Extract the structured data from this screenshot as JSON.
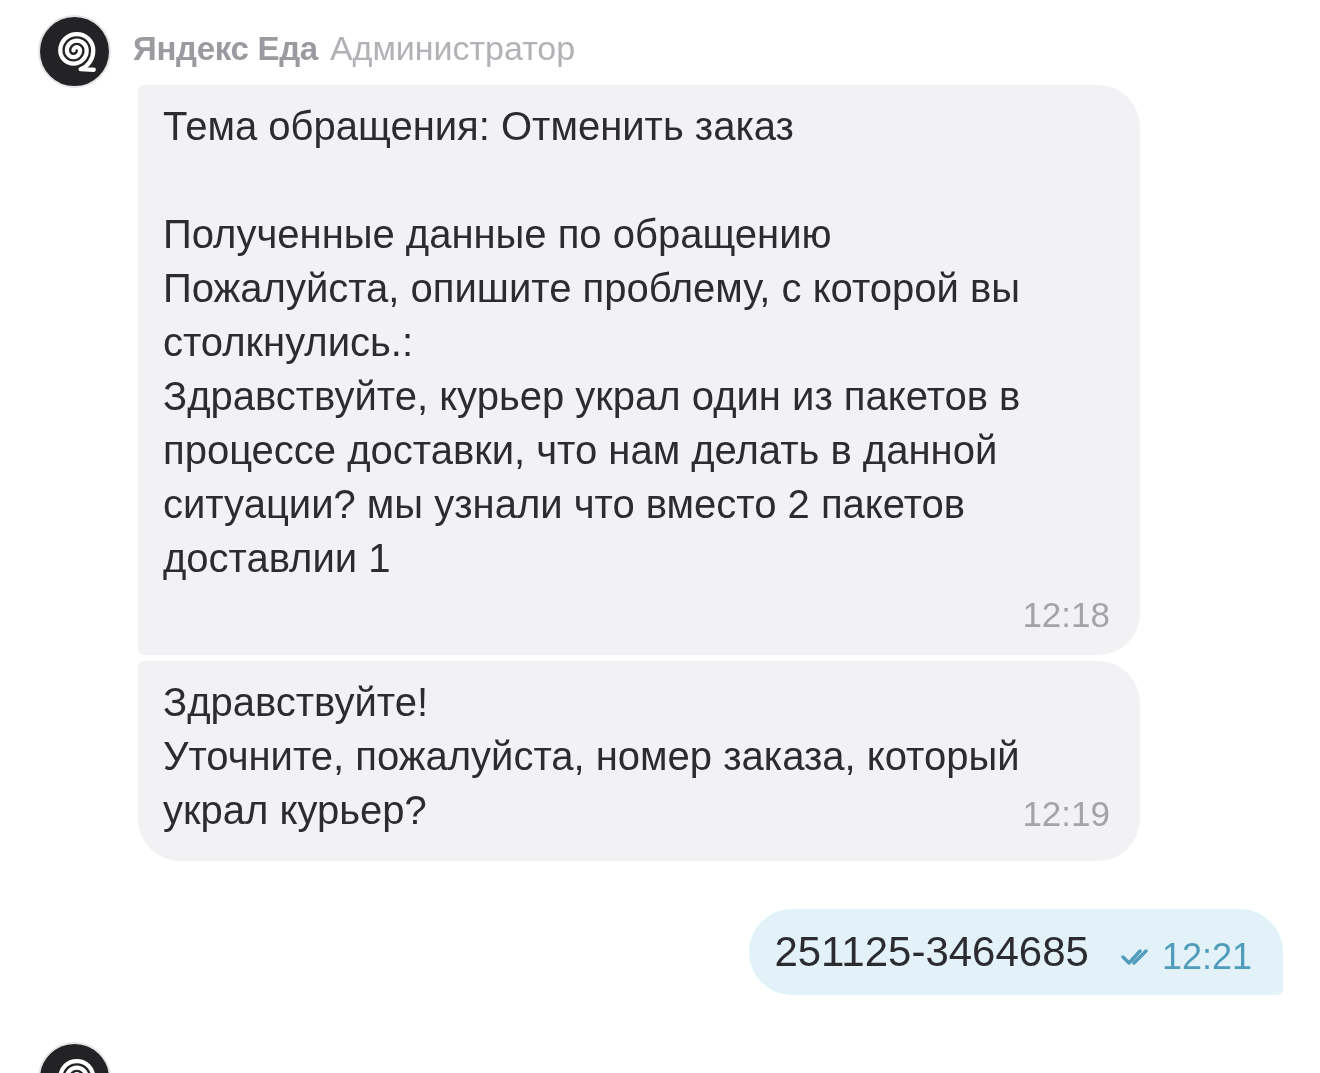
{
  "groups": [
    {
      "kind": "incoming",
      "sender": {
        "name": "Яндекс Еда",
        "role": "Администратор"
      },
      "messages": [
        {
          "kind": "ticket",
          "text": "Тема обращения: Отменить заказ\n\nПолученные данные по обращению\nПожалуйста, опишите проблему, с которой вы столкнулись.:\nЗдравствуйте, курьер украл один из пакетов в процессе доставки, что нам делать в данной ситуации? мы узнали что вместо 2 пакетов доставлии 1",
          "time": "12:18"
        },
        {
          "kind": "text",
          "text": "Здравствуйте!\nУточните, пожалуйста, номер заказа, который украл курьер?",
          "time": "12:19"
        }
      ]
    },
    {
      "kind": "outgoing",
      "messages": [
        {
          "kind": "text",
          "text": "251125-3464685",
          "time": "12:21",
          "read": true
        }
      ]
    },
    {
      "kind": "incoming"
    }
  ]
}
